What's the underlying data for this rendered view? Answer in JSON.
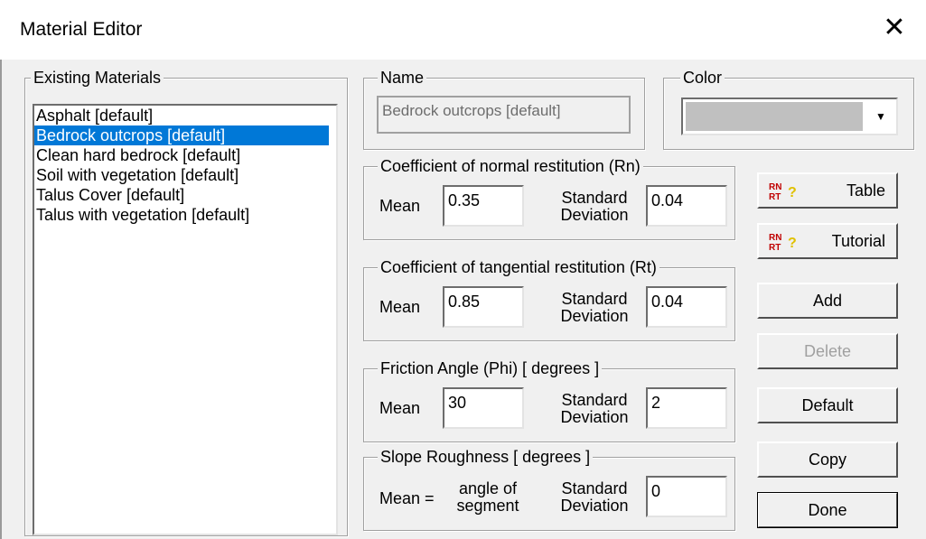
{
  "window": {
    "title": "Material Editor"
  },
  "existing_materials": {
    "label": "Existing Materials",
    "items": [
      "Asphalt [default]",
      "Bedrock outcrops [default]",
      "Clean hard bedrock [default]",
      "Soil with vegetation [default]",
      "Talus Cover [default]",
      "Talus with vegetation [default]"
    ],
    "selected": "Bedrock outcrops [default]"
  },
  "name": {
    "label": "Name",
    "value": "Bedrock outcrops [default]"
  },
  "color": {
    "label": "Color",
    "value": "#c0c0c0"
  },
  "rn": {
    "label": "Coefficient of normal restitution (Rn)",
    "mean_label": "Mean",
    "mean": "0.35",
    "sd_label_1": "Standard",
    "sd_label_2": "Deviation",
    "sd": "0.04"
  },
  "rt": {
    "label": "Coefficient of tangential restitution (Rt)",
    "mean_label": "Mean",
    "mean": "0.85",
    "sd_label_1": "Standard",
    "sd_label_2": "Deviation",
    "sd": "0.04"
  },
  "phi": {
    "label": "Friction Angle (Phi) [ degrees ]",
    "mean_label": "Mean",
    "mean": "30",
    "sd_label_1": "Standard",
    "sd_label_2": "Deviation",
    "sd": "2"
  },
  "roughness": {
    "label": "Slope Roughness [ degrees ]",
    "mean_label": "Mean =",
    "angle_label_1": "angle of",
    "angle_label_2": "segment",
    "sd_label_1": "Standard",
    "sd_label_2": "Deviation",
    "sd": "0"
  },
  "buttons": {
    "table": "Table",
    "tutorial": "Tutorial",
    "add": "Add",
    "delete": "Delete",
    "default": "Default",
    "copy": "Copy",
    "done": "Done"
  },
  "icons": {
    "rnrt_top": "RN",
    "rnrt_bottom": "RT",
    "help": "?"
  }
}
